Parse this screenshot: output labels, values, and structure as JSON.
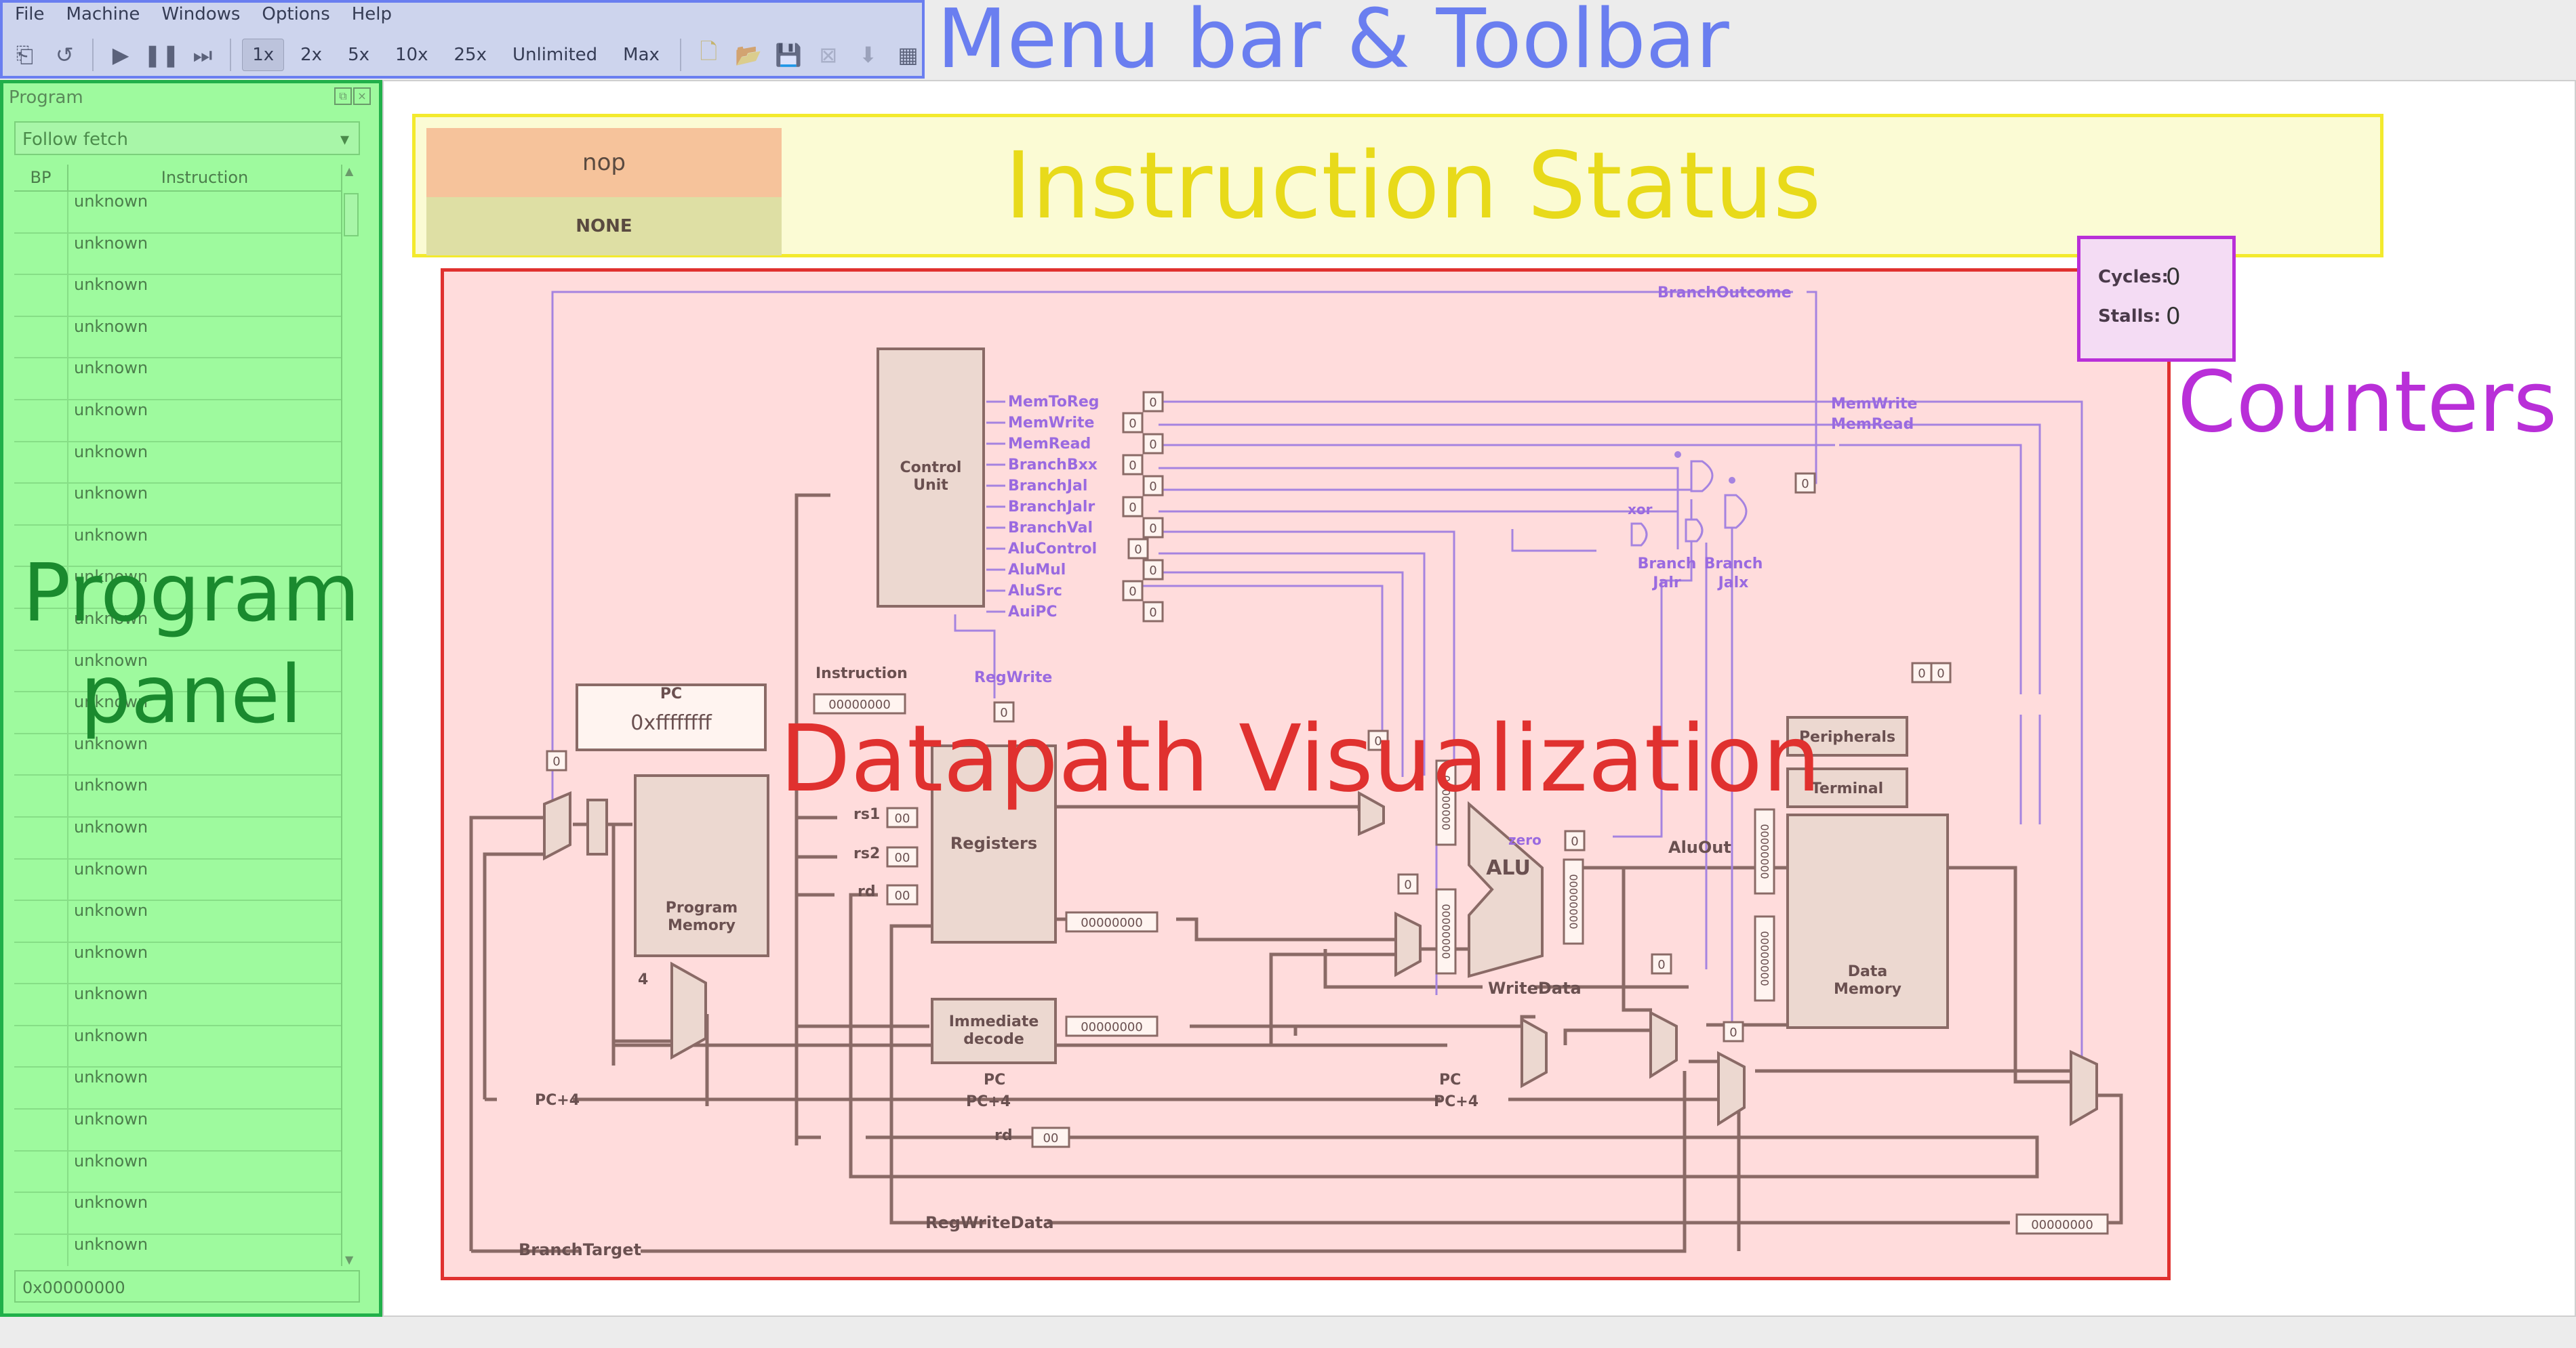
{
  "menu": {
    "items": [
      "File",
      "Machine",
      "Windows",
      "Options",
      "Help"
    ]
  },
  "toolbar": {
    "speeds": [
      "1x",
      "2x",
      "5x",
      "10x",
      "25x",
      "Unlimited",
      "Max"
    ],
    "active_speed": "1x",
    "icons": [
      "reset-icon",
      "undo-icon",
      "run-icon",
      "pause-icon",
      "step-icon",
      "new-file-icon",
      "open-folder-icon",
      "save-icon",
      "close-icon",
      "download-icon",
      "memory-chip-icon"
    ]
  },
  "overlay_labels": {
    "menu": "Menu bar & Toolbar",
    "status": "Instruction Status",
    "counters": "Counters",
    "program": "Program\npanel",
    "datapath": "Datapath Visualization"
  },
  "overlay_colors": {
    "menu": "#6a7ef0",
    "status": "#e8da1a",
    "counters": "#b92fd8",
    "program": "#1a8a2e",
    "datapath": "#e0312f"
  },
  "program": {
    "title": "Program",
    "follow_select": "Follow fetch",
    "col_bp": "BP",
    "col_instruction": "Instruction",
    "rows": [
      "unknown",
      "unknown",
      "unknown",
      "unknown",
      "unknown",
      "unknown",
      "unknown",
      "unknown",
      "unknown",
      "unknown",
      "unknown",
      "unknown",
      "unknown",
      "unknown",
      "unknown",
      "unknown",
      "unknown",
      "unknown",
      "unknown",
      "unknown",
      "unknown",
      "unknown",
      "unknown",
      "unknown",
      "unknown",
      "unknown",
      "unknown"
    ],
    "address": "0x00000000"
  },
  "status": {
    "instruction": "nop",
    "stage": "NONE"
  },
  "counters": {
    "cycles_label": "Cycles:",
    "cycles": "0",
    "stalls_label": "Stalls:",
    "stalls": "0"
  },
  "datapath": {
    "blocks": {
      "control": "Control\nUnit",
      "pc": "PC",
      "pc_value": "0xffffffff",
      "program_memory": "Program\nMemory",
      "registers": "Registers",
      "immediate": "Immediate\ndecode",
      "alu": "ALU",
      "data_memory": "Data\nMemory",
      "peripherals": "Peripherals",
      "terminal": "Terminal"
    },
    "control_signals": [
      {
        "name": "MemToReg",
        "value": "0"
      },
      {
        "name": "MemWrite",
        "value": "0"
      },
      {
        "name": "MemRead",
        "value": "0"
      },
      {
        "name": "BranchBxx",
        "value": "0"
      },
      {
        "name": "BranchJal",
        "value": "0"
      },
      {
        "name": "BranchJalr",
        "value": "0"
      },
      {
        "name": "BranchVal",
        "value": "0"
      },
      {
        "name": "AluControl",
        "value": "0"
      },
      {
        "name": "AluMul",
        "value": "0"
      },
      {
        "name": "AluSrc",
        "value": "0"
      },
      {
        "name": "AuiPC",
        "value": "0"
      }
    ],
    "labels": {
      "branch_outcome": "BranchOutcome",
      "instruction": "Instruction",
      "instruction_value": "00000000",
      "regwrite": "RegWrite",
      "rs1": "rs1",
      "rs2": "rs2",
      "rd": "rd",
      "four": "4",
      "pc_plus4": "PC+4",
      "pc": "PC",
      "rd_bottom": "rd",
      "regwritedata": "RegWriteData",
      "branchtarget": "BranchTarget",
      "writedata": "WriteData",
      "aluout": "AluOut",
      "zero": "zero",
      "xor": "xor",
      "branch_jalr": "Branch\nJalr",
      "branch_jalx": "Branch\nJalx",
      "memwrite_right": "MemWrite",
      "memread_right": "MemRead",
      "zero_small": "0",
      "reg_index": "00",
      "word": "00000000"
    }
  }
}
